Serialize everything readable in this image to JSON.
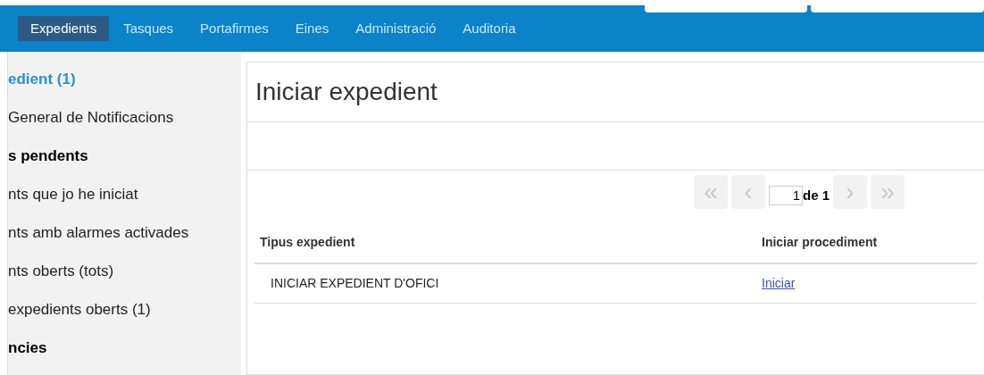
{
  "nav": {
    "tabs": [
      {
        "label": "Expedients",
        "selected": true
      },
      {
        "label": "Tasques",
        "selected": false
      },
      {
        "label": "Portafirmes",
        "selected": false
      },
      {
        "label": "Eines",
        "selected": false
      },
      {
        "label": "Administració",
        "selected": false
      },
      {
        "label": "Auditoria",
        "selected": false
      }
    ]
  },
  "sidebar": {
    "items": [
      {
        "kind": "active",
        "label": "edient (1)"
      },
      {
        "kind": "item",
        "label": "General de Notificacions"
      },
      {
        "kind": "heading",
        "label": "s pendents"
      },
      {
        "kind": "item",
        "label": "nts que jo he iniciat"
      },
      {
        "kind": "item",
        "label": "nts amb alarmes activades"
      },
      {
        "kind": "item",
        "label": "nts oberts (tots)"
      },
      {
        "kind": "item",
        "label": "expedients oberts (1)"
      },
      {
        "kind": "heading",
        "label": "ncies"
      }
    ]
  },
  "main": {
    "title": "Iniciar expedient",
    "pagination": {
      "first": "«",
      "prev": "‹",
      "page": "1",
      "of": "de 1",
      "next": "›",
      "last": "»"
    },
    "table": {
      "columns": [
        "Tipus expedient",
        "Iniciar procediment"
      ],
      "rows": [
        {
          "type": "INICIAR EXPEDIENT D'OFICI",
          "action": "Iniciar"
        }
      ]
    }
  }
}
